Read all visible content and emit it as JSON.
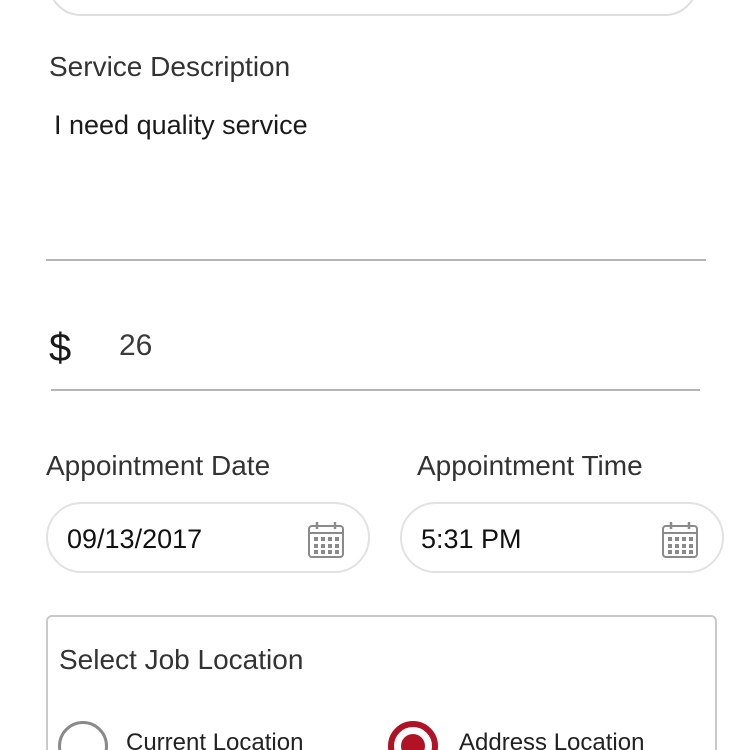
{
  "service": {
    "description_label": "Service Description",
    "description_value": "I need quality service"
  },
  "price": {
    "currency_symbol": "$",
    "amount": "26"
  },
  "appointment": {
    "date_label": "Appointment Date",
    "date_value": "09/13/2017",
    "time_label": "Appointment Time",
    "time_value": "5:31 PM"
  },
  "location": {
    "title": "Select Job Location",
    "options": [
      {
        "label": "Current Location",
        "selected": false
      },
      {
        "label": "Address Location",
        "selected": true
      }
    ]
  },
  "icons": {
    "date_picker": "calendar-icon",
    "time_picker": "calendar-icon"
  },
  "colors": {
    "accent": "#b01226",
    "divider": "#b5b5b5",
    "pill_border": "#e2e2e2"
  }
}
